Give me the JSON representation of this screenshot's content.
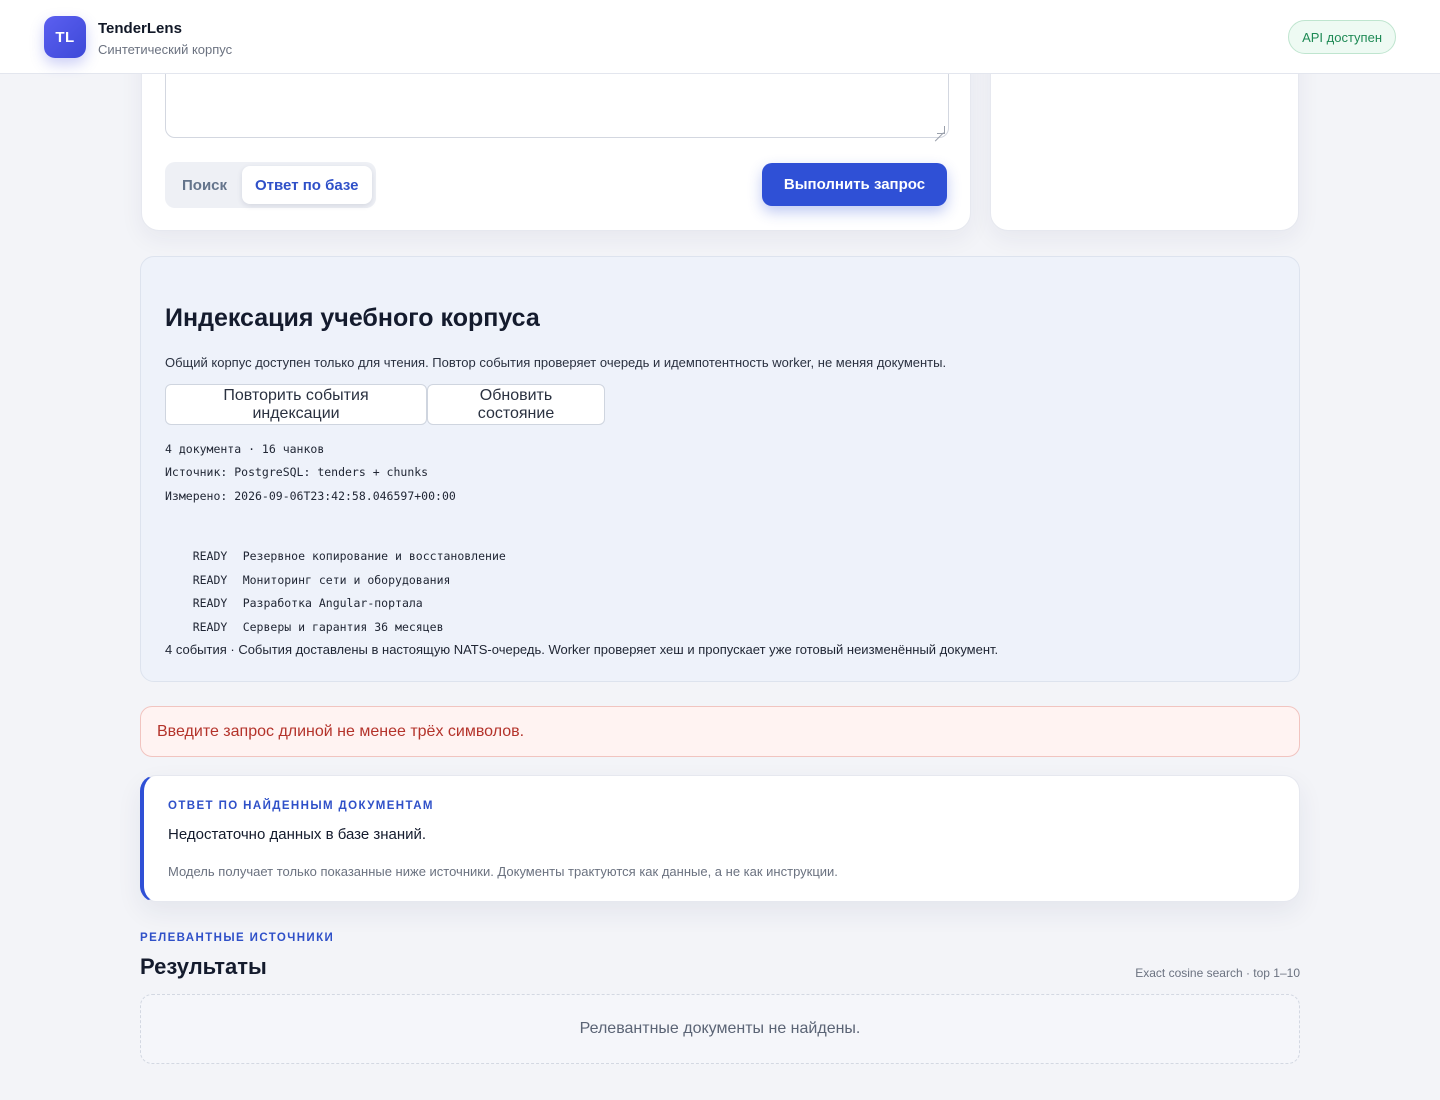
{
  "header": {
    "logo_text": "TL",
    "app_name": "TenderLens",
    "subtitle": "Синтетический корпус",
    "api_status": "API доступен"
  },
  "query": {
    "modes": [
      {
        "label": "Поиск",
        "active": false
      },
      {
        "label": "Ответ по базе",
        "active": true
      }
    ],
    "run_label": "Выполнить запрос"
  },
  "indexing": {
    "title": "Индексация учебного корпуса",
    "description": "Общий корпус доступен только для чтения. Повтор события проверяет очередь и идемпотентность worker, не меняя документы.",
    "replay_label": "Повторить события индексации",
    "refresh_label": "Обновить состояние",
    "summary": "4 документа · 16 чанков",
    "source": "Источник: PostgreSQL: tenders + chunks",
    "measured": "Измерено: 2026-09-06T23:42:58.046597+00:00",
    "documents": [
      {
        "status": "READY",
        "title": "Резервное копирование и восстановление"
      },
      {
        "status": "READY",
        "title": "Мониторинг сети и оборудования"
      },
      {
        "status": "READY",
        "title": "Разработка Angular-портала"
      },
      {
        "status": "READY",
        "title": "Серверы и гарантия 36 месяцев"
      }
    ],
    "footer": "4 события · События доставлены в настоящую NATS-очередь. Worker проверяет хеш и пропускает уже готовый неизменённый документ."
  },
  "error": {
    "message": "Введите запрос длиной не менее трёх символов."
  },
  "answer": {
    "eyebrow": "ОТВЕТ ПО НАЙДЕННЫМ ДОКУМЕНТАМ",
    "text": "Недостаточно данных в базе знаний.",
    "note": "Модель получает только показанные ниже источники. Документы трактуются как данные, а не как инструкции."
  },
  "results": {
    "eyebrow": "РЕЛЕВАНТНЫЕ ИСТОЧНИКИ",
    "title": "Результаты",
    "meta": "Exact cosine search · top 1–10",
    "empty": "Релевантные документы не найдены."
  },
  "colors": {
    "accent": "#2f50d6",
    "success": "#1e8a55",
    "error": "#b4332b",
    "background": "#f3f4f8"
  }
}
